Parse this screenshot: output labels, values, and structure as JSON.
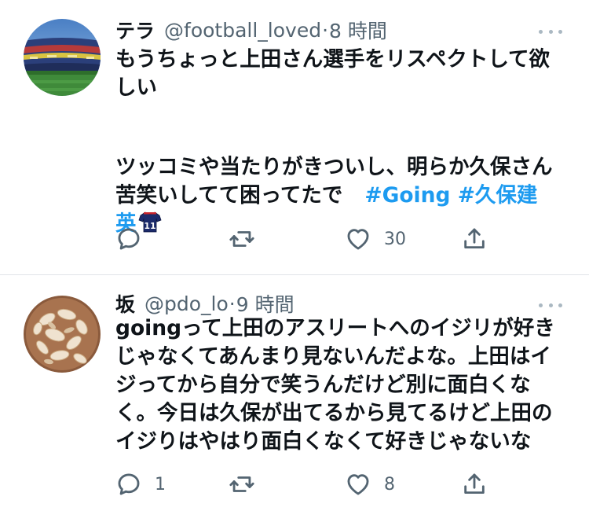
{
  "colors": {
    "text": "#0f1419",
    "secondary": "#536471",
    "hashtag": "#1d9bf0",
    "divider": "#e1e4e8"
  },
  "tweets": [
    {
      "avatar": "stadium-photo",
      "display_name": "テラ",
      "handle": "@football_loved",
      "separator": "·",
      "time": "8 時間",
      "lines": [
        "もうちょっと上田さん選手をリスペクトして欲",
        "しい",
        "",
        "ツッコミや当たりがきついし、明らか久保さん",
        "苦笑いしてて困ってたで"
      ],
      "hashtags": [
        "#Going",
        "#久保建",
        "英"
      ],
      "emoji": "jersey-11-emoji",
      "actions": {
        "reply_count": "",
        "retweet_count": "",
        "like_count": "30"
      }
    },
    {
      "avatar": "almond-slices-photo",
      "display_name": "坂",
      "handle": "@pdo_lo",
      "separator": "·",
      "time": "9 時間",
      "lines": [
        "goingって上田のアスリートへのイジリが好き",
        "じゃなくてあんまり見ないんだよな。上田はイ",
        "ジってから自分で笑うんだけど別に面白くな",
        "く。今日は久保が出てるから見てるけど上田の",
        "イジりはやはり面白くなくて好きじゃないな"
      ],
      "actions": {
        "reply_count": "1",
        "retweet_count": "",
        "like_count": "8"
      }
    }
  ]
}
